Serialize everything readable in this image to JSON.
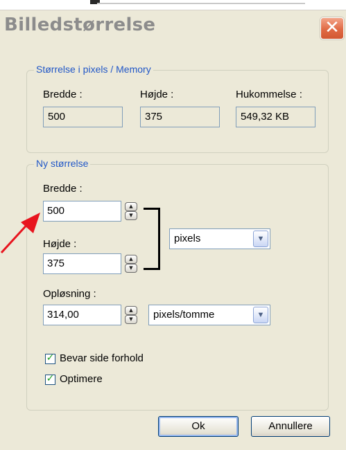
{
  "dialog": {
    "title": "Billedstørrelse",
    "close_glyph": "✕"
  },
  "current_size": {
    "legend": "Størrelse i pixels / Memory",
    "width_label": "Bredde :",
    "width_value": "500",
    "height_label": "Højde :",
    "height_value": "375",
    "memory_label": "Hukommelse :",
    "memory_value": "549,32 KB"
  },
  "new_size": {
    "legend": "Ny størrelse",
    "width_label": "Bredde :",
    "width_value": "500",
    "height_label": "Højde :",
    "height_value": "375",
    "unit_selected": "pixels",
    "resolution_label": "Opløsning :",
    "resolution_value": "314,00",
    "resolution_unit_selected": "pixels/tomme",
    "keep_ratio_label": "Bevar side forhold",
    "keep_ratio_checked": true,
    "optimize_label": "Optimere",
    "optimize_checked": true
  },
  "buttons": {
    "ok_label": "Ok",
    "cancel_label": "Annullere"
  },
  "icons": {
    "spinner": "spinner-updown-icon",
    "dropdown": "chevron-down-icon",
    "check": "checkmark-icon",
    "pointer": "red-arrow-icon"
  },
  "colors": {
    "dialog_bg": "#ece9d8",
    "legend_text": "#2157c7",
    "title_text": "#8c8c8c",
    "close_button": "#e06a45",
    "arrow": "#e8141e",
    "check_mark": "#21a121"
  }
}
